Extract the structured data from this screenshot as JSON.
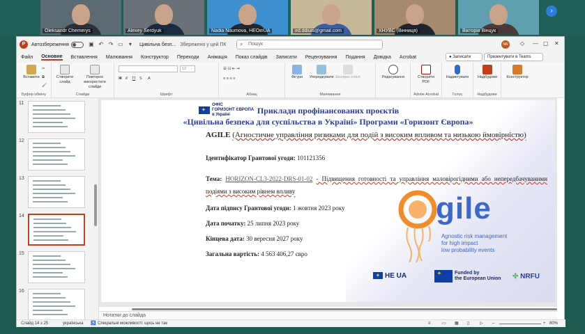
{
  "participants": [
    {
      "name": "Oleksandr Chemerys",
      "bg": "#5b6a70",
      "shirt": "#2b2f38"
    },
    {
      "name": "Alexey Serdyuk",
      "bg": "#6a7278",
      "shirt": "#1c2a3f"
    },
    {
      "name": "Nadia Naumova, HEOinUA",
      "bg": "#3d8fd0",
      "shirt": "#23282e"
    },
    {
      "name": "ird.ddiuis@gmail.com",
      "bg": "#c7b89a",
      "shirt": "#3a5ea0"
    },
    {
      "name": "ХНУВС (Вінниця)",
      "bg": "#a58a6f",
      "shirt": "#20252d"
    },
    {
      "name": "Вікторія Вінцук",
      "bg": "#5f9fb0",
      "shirt": "#4a3a3a"
    }
  ],
  "titlebar": {
    "autosave": "Автозбереження",
    "doc": "Цивільна безп...",
    "saved": "Збережено у цей ПК",
    "search": "Пошук",
    "user_initials": "NN"
  },
  "menu": {
    "items": [
      "Файл",
      "Основне",
      "Вставлення",
      "Малювання",
      "Конструктор",
      "Переходи",
      "Анімація",
      "Показ слайдів",
      "Записати",
      "Рецензування",
      "Подання",
      "Довідка",
      "Acrobat"
    ],
    "record": "Записати",
    "present_teams": "Презентувати в Teams"
  },
  "ribbon": {
    "paste": "Вставити",
    "clipboard": "Буфер обміну",
    "new_slide": "Створити слайд",
    "reuse": "Повторно використати слайди",
    "slides": "Слайди",
    "font": "Шрифт",
    "font_size": "12",
    "paragraph": "Абзац",
    "shapes": "Фігури",
    "arrange": "Упорядкувати",
    "quick_styles": "Експрес-стилі",
    "drawing": "Малювання",
    "editing": "Редагування",
    "create_pdf": "Створити PDF",
    "adobe": "Adobe Acrobat",
    "dictate": "Надиктувати",
    "voice": "Голос",
    "addins": "Надбудови",
    "designer": "Конструктор"
  },
  "thumbnails": [
    {
      "num": "11"
    },
    {
      "num": "12"
    },
    {
      "num": "13"
    },
    {
      "num": "14",
      "selected": true
    },
    {
      "num": "15"
    },
    {
      "num": "16"
    }
  ],
  "slide": {
    "office_logo": "ОФІС\nГОРИЗОНТ ЄВРОПА\nв Україні",
    "title1": "Приклади профінансованих проєктів",
    "title2": "«Цивільна безпека для суспільства в Україні» Програми «Горизонт Європа»",
    "agile_name": "AGILE",
    "agile_desc": "(Агностичне управління ризиками для подій з високим впливом та низькою ймовірністю)",
    "grant_label": "Ідентифікатор Грантової угоди:",
    "grant_id": "101121356",
    "topic_label": "Тема:",
    "topic_code": "HORIZON-CL3-2022-DRS-01-02",
    "topic_text": "- Підвищення готовності та управління маловірогідними або непередбачуваними подіями з високим рівнем впливу",
    "sign_label": "Дата підпису Грантової угоди:",
    "sign_date": "1 жовтня 2023 року",
    "start_label": "Дата початку:",
    "start_date": "25 липня 2023 року",
    "end_label": "Кінцева дата:",
    "end_date": "30 вересня 2027 року",
    "cost_label": "Загальна вартість:",
    "cost": "4 563 406,27 євро",
    "logo_word": "gile",
    "logo_sub": "Agnostic risk management\nfor high impact\nlow probability events",
    "heoua": "HE UA",
    "funded": "Funded by\nthe European Union",
    "nrfu": "NRFU"
  },
  "notes": "Нотатки до слайда",
  "status": {
    "slide": "Слайд 14 з 25",
    "lang": "українська",
    "accessibility": "Спеціальні можливості: щось не так",
    "zoom": "80%"
  }
}
